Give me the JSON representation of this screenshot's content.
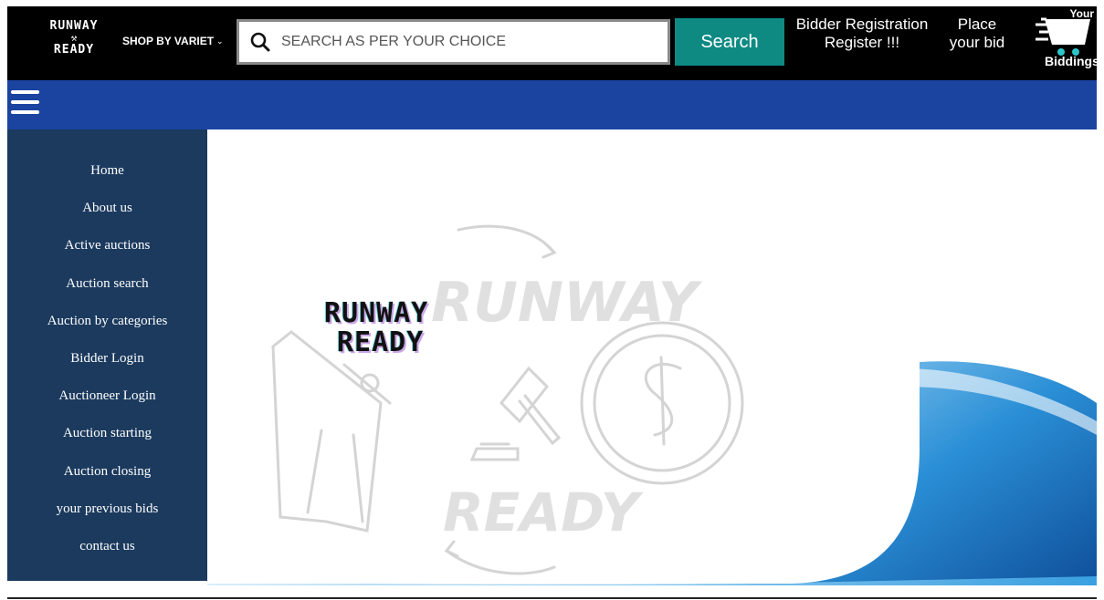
{
  "header": {
    "logo": {
      "line1": "RUNWAY",
      "line2": "⚒",
      "line3": "READY"
    },
    "shop_by": {
      "label": "SHOP BY VARIET",
      "chevron": "⌄"
    },
    "search": {
      "placeholder": "SEARCH AS PER YOUR CHOICE",
      "value": "",
      "icon": "search-icon",
      "button_label": "Search"
    },
    "bidder_registration": {
      "line1": "Bidder Registration",
      "line2": "Register !!!"
    },
    "place_bid": {
      "line1": "Place",
      "line2": "your bid"
    },
    "cart": {
      "top_label": "Your",
      "bottom_label": "Biddings",
      "icon": "cart-icon"
    }
  },
  "navbar": {
    "menu_icon": "hamburger-menu-icon",
    "color": "#1a44a0"
  },
  "sidebar": {
    "items": [
      {
        "label": "Home"
      },
      {
        "label": "About us"
      },
      {
        "label": "Active auctions"
      },
      {
        "label": "Auction search"
      },
      {
        "label": "Auction by categories"
      },
      {
        "label": "Bidder Login"
      },
      {
        "label": "Auctioneer Login"
      },
      {
        "label": "Auction starting"
      },
      {
        "label": "Auction closing"
      },
      {
        "label": "your previous bids"
      },
      {
        "label": "contact us"
      }
    ]
  },
  "hero": {
    "brand_line1": "RUNWAY",
    "brand_line2": "READY",
    "watermark_top": "RUNWAY",
    "watermark_bottom": "READY"
  },
  "colors": {
    "topbar": "#000000",
    "search_button": "#0e8a83",
    "sidebar": "#1b3a5e",
    "wave": "#2a8fd6"
  }
}
